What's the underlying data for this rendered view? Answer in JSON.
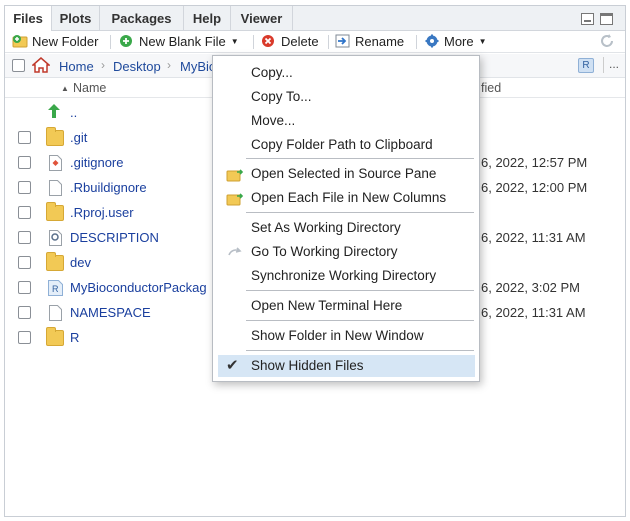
{
  "tabs": [
    "Files",
    "Plots",
    "Packages",
    "Help",
    "Viewer"
  ],
  "active_tab": "Files",
  "toolbar": {
    "new_folder": "New Folder",
    "new_blank_file": "New Blank File",
    "delete": "Delete",
    "rename": "Rename",
    "more": "More"
  },
  "breadcrumb": [
    "Home",
    "Desktop",
    "MyBio"
  ],
  "columns": {
    "name": "Name",
    "modified": "fied"
  },
  "parent_dir": "..",
  "files": [
    {
      "name": ".git",
      "icon": "folder-icon",
      "modified": ""
    },
    {
      "name": ".gitignore",
      "icon": "git-file-icon",
      "modified": "6, 2022, 12:57 PM"
    },
    {
      "name": ".Rbuildignore",
      "icon": "document-icon",
      "modified": "6, 2022, 12:00 PM"
    },
    {
      "name": ".Rproj.user",
      "icon": "folder-icon",
      "modified": ""
    },
    {
      "name": "DESCRIPTION",
      "icon": "description-file-icon",
      "modified": "6, 2022, 11:31 AM"
    },
    {
      "name": "dev",
      "icon": "folder-icon",
      "modified": ""
    },
    {
      "name": "MyBioconductorPackag",
      "icon": "rproj-icon",
      "modified": "6, 2022, 3:02 PM"
    },
    {
      "name": "NAMESPACE",
      "icon": "document-icon",
      "modified": "6, 2022, 11:31 AM"
    },
    {
      "name": "R",
      "icon": "folder-icon",
      "modified": ""
    }
  ],
  "menu": {
    "copy": "Copy...",
    "copy_to": "Copy To...",
    "move": "Move...",
    "copy_path": "Copy Folder Path to Clipboard",
    "open_source": "Open Selected in Source Pane",
    "open_columns": "Open Each File in New Columns",
    "set_wd": "Set As Working Directory",
    "go_wd": "Go To Working Directory",
    "sync_wd": "Synchronize Working Directory",
    "terminal": "Open New Terminal Here",
    "new_window": "Show Folder in New Window",
    "hidden": "Show Hidden Files"
  },
  "colors": {
    "link": "#1a3f9e",
    "folder": "#f2c955",
    "menu_selected": "#d6e6f5"
  }
}
